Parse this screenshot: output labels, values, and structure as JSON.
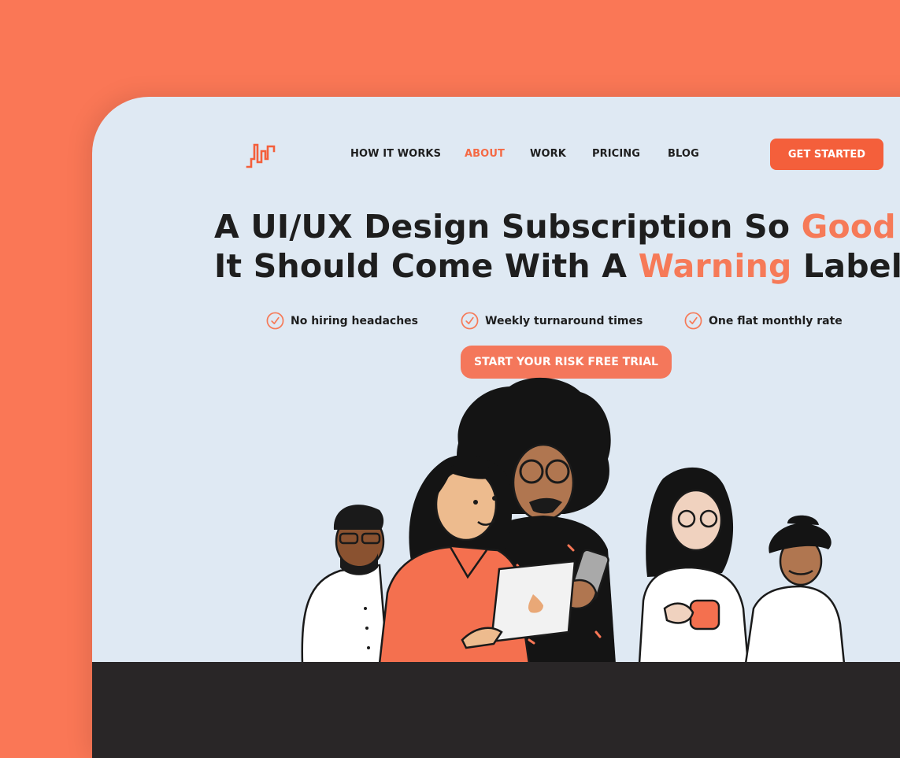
{
  "brand": {
    "logo_icon": "pulse-bars-logo-icon",
    "accent": "#F45F3B",
    "highlight": "#F67A58"
  },
  "nav": {
    "items": [
      {
        "label": "HOW IT WORKS",
        "active": false
      },
      {
        "label": "ABOUT",
        "active": true
      },
      {
        "label": "WORK",
        "active": false
      },
      {
        "label": "PRICING",
        "active": false
      },
      {
        "label": "BLOG",
        "active": false
      }
    ],
    "cta_label": "GET STARTED"
  },
  "hero": {
    "line1_pre": "A UI/UX Design Subscription So ",
    "line1_highlight": "Good",
    "line2_pre": "It Should Come With A ",
    "line2_highlight": "Warning",
    "line2_post": " Label",
    "features": [
      {
        "icon": "check-circle-icon",
        "label": "No hiring headaches"
      },
      {
        "icon": "check-circle-icon",
        "label": "Weekly turnaround times"
      },
      {
        "icon": "check-circle-icon",
        "label": "One flat monthly rate"
      }
    ],
    "trial_label": "START YOUR RISK FREE TRIAL"
  },
  "colors": {
    "page_background": "#FA7756",
    "frame_background": "#DFE9F3",
    "footer_band": "#292627",
    "text": "#1E1E1E"
  }
}
